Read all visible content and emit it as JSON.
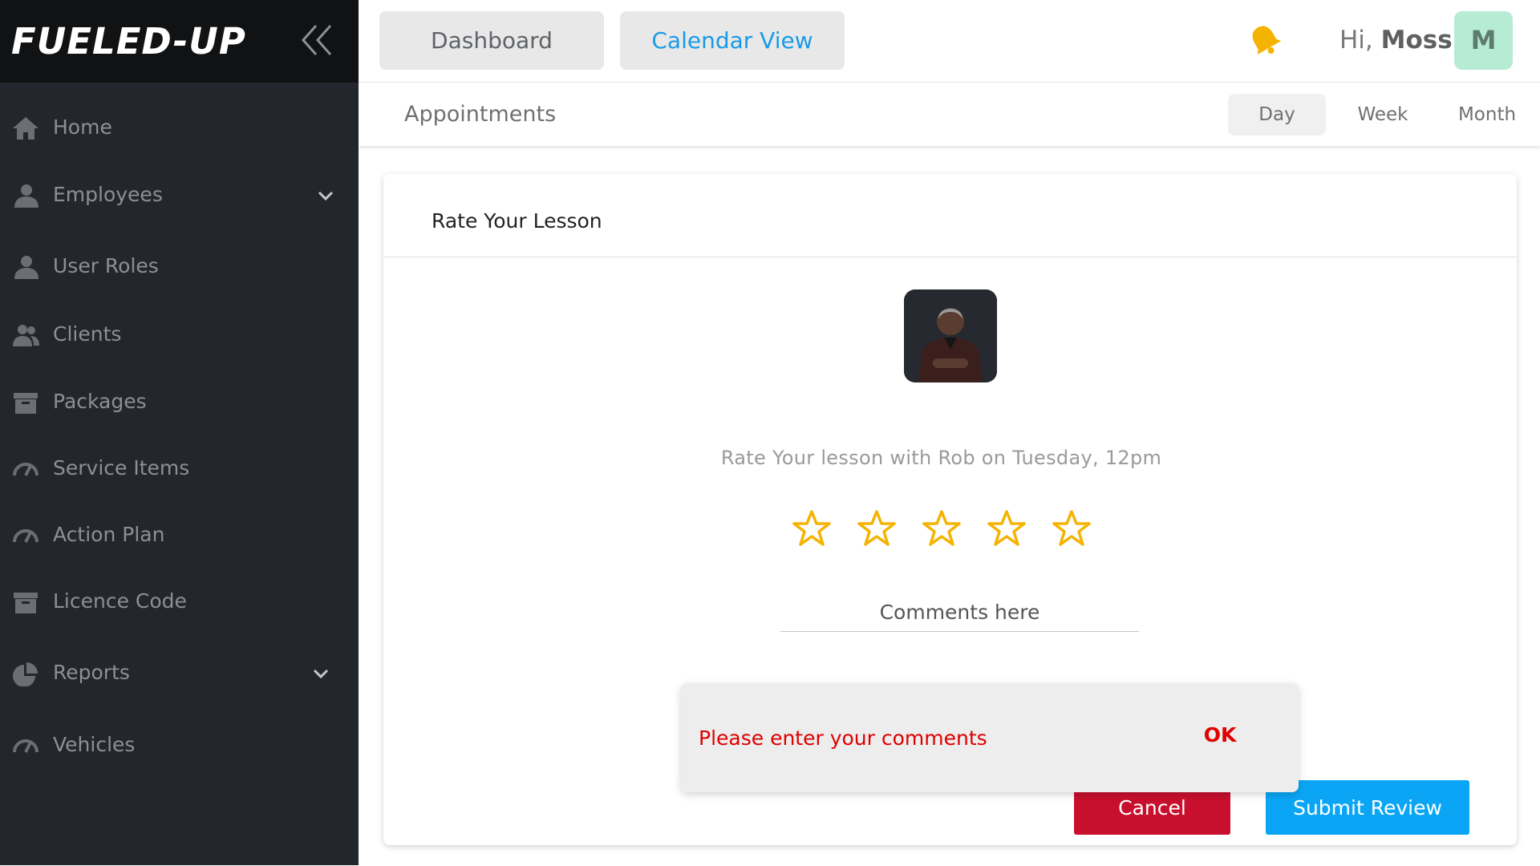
{
  "brand": {
    "title": "FUELED-UP"
  },
  "sidebar": {
    "items": [
      {
        "label": "Home",
        "icon": "home-icon"
      },
      {
        "label": "Employees",
        "icon": "user-icon",
        "expandable": true
      },
      {
        "label": "User Roles",
        "icon": "user-icon"
      },
      {
        "label": "Clients",
        "icon": "users-icon"
      },
      {
        "label": "Packages",
        "icon": "archive-icon"
      },
      {
        "label": "Service Items",
        "icon": "gauge-icon"
      },
      {
        "label": "Action Plan",
        "icon": "gauge-icon"
      },
      {
        "label": "Licence Code",
        "icon": "archive-icon"
      },
      {
        "label": "Reports",
        "icon": "pie-chart-icon",
        "expandable": true
      },
      {
        "label": "Vehicles",
        "icon": "gauge-icon"
      }
    ]
  },
  "header": {
    "dashboard_label": "Dashboard",
    "calendar_label": "Calendar View",
    "greeting_prefix": "Hi,",
    "user_name": "Moss",
    "avatar_initial": "M",
    "bell_color": "#f5b301"
  },
  "subbar": {
    "title": "Appointments",
    "tabs": [
      {
        "label": "Day",
        "selected": true
      },
      {
        "label": "Week",
        "selected": false
      },
      {
        "label": "Month",
        "selected": false
      }
    ]
  },
  "rating_card": {
    "title": "Rate Your Lesson",
    "prompt": "Rate Your lesson with Rob on Tuesday, 12pm",
    "star_count": 5,
    "rating": 0,
    "star_color": "#f5b301",
    "comment_placeholder": "Comments here",
    "cancel_label": "Cancel",
    "submit_label": "Submit Review"
  },
  "snackbar": {
    "message": "Please enter your comments",
    "action_label": "OK"
  },
  "colors": {
    "sidebar_bg": "#23272d",
    "brand_bg": "#111213",
    "accent_blue": "#0aa6f5",
    "danger_red": "#c8102e",
    "avatar_bg": "#b5ecd3"
  }
}
